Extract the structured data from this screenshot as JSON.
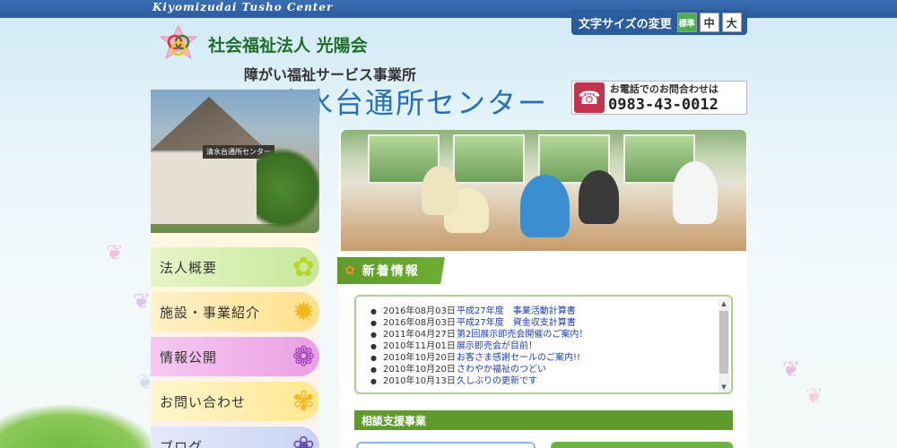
{
  "header": {
    "top_title": "Kiyomizudai Tusho Center",
    "org_name": "社会福祉法人 光陽会",
    "org_sub": "障がい福祉サービス事業所",
    "center_name": "清水台通所センター",
    "building_sign": "清水台通所センター"
  },
  "font_size": {
    "label": "文字サイズの変更",
    "options": [
      "標準",
      "中",
      "大"
    ],
    "selected": "標準"
  },
  "contact": {
    "label": "お電話でのお問合わせは",
    "number": "0983-43-0012"
  },
  "nav": {
    "items": [
      {
        "label": "法人概要",
        "icon": "lily-icon"
      },
      {
        "label": "施設・事業紹介",
        "icon": "sunflower-icon"
      },
      {
        "label": "情報公開",
        "icon": "allium-icon"
      },
      {
        "label": "お問い合わせ",
        "icon": "gerbera-icon"
      },
      {
        "label": "ブログ",
        "icon": "iris-icon"
      }
    ]
  },
  "news": {
    "heading": "新着情報",
    "items": [
      {
        "date": "2016年08月03日",
        "title": "平成27年度　事業活動計算書"
      },
      {
        "date": "2016年08月03日",
        "title": "平成27年度　資金収支計算書"
      },
      {
        "date": "2011年04月27日",
        "title": "第2回展示即売会開催のご案内！"
      },
      {
        "date": "2010年11月01日",
        "title": "展示即売会が目前！"
      },
      {
        "date": "2010年10月20日",
        "title": "お客さま感謝セールのご案内!!"
      },
      {
        "date": "2010年10月20日",
        "title": "さわやか福祉のつどい"
      },
      {
        "date": "2010年10月13日",
        "title": "久しぶりの更新です"
      }
    ]
  },
  "consult": {
    "heading": "相談支援事業"
  },
  "colors": {
    "top_bar": "#2a5c9e",
    "green_accent": "#5f9b2a",
    "link": "#1a3fb3",
    "phone_red": "#c4334d"
  }
}
